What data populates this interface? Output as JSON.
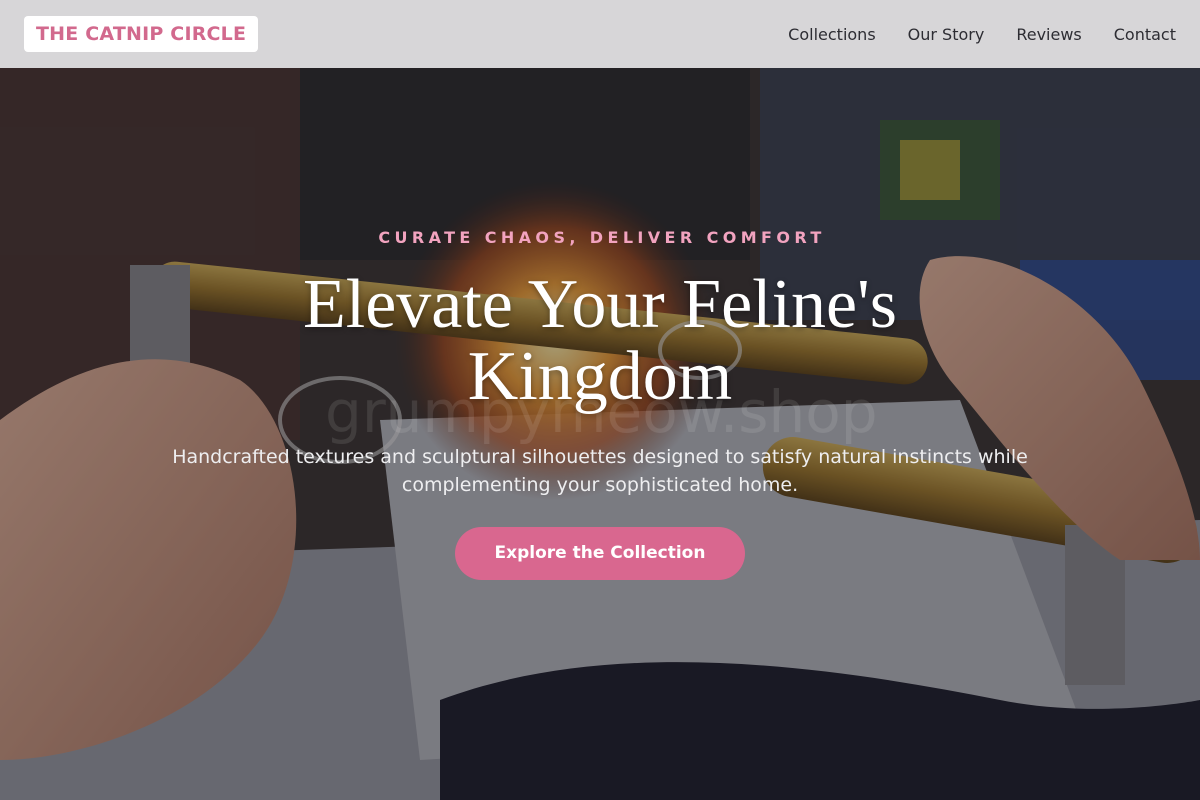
{
  "brand": {
    "name": "THE CATNIP CIRCLE",
    "accent": "#d9678f"
  },
  "nav": {
    "links": [
      "Collections",
      "Our Story",
      "Reviews",
      "Contact"
    ]
  },
  "hero": {
    "eyebrow": "CURATE CHAOS, DELIVER COMFORT",
    "headline": "Elevate Your Feline's Kingdom",
    "subhead": "Handcrafted textures and sculptural silhouettes designed to satisfy natural instincts while complementing your sophisticated home.",
    "cta_label": "Explore the Collection",
    "background_image": "glassblowing-hands-torch-photo",
    "watermark": "grumpymeow.shop"
  }
}
